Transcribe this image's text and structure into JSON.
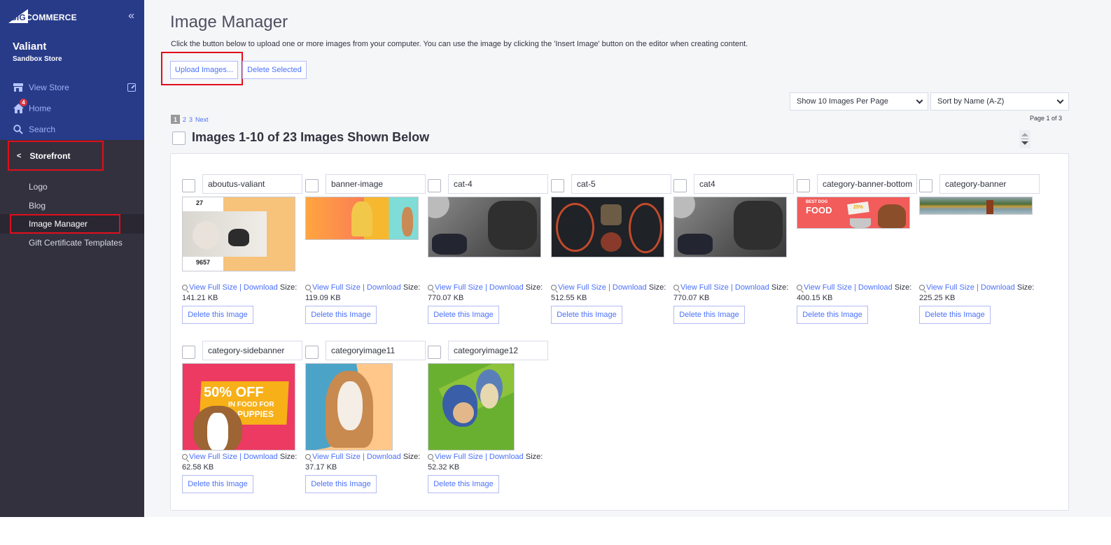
{
  "sidebar": {
    "logo": {
      "big": "BIG",
      "rest": "COMMERCE"
    },
    "collapse_icon": "«",
    "store_name": "Valiant",
    "store_sub": "Sandbox Store",
    "nav": {
      "view_store": "View Store",
      "home": "Home",
      "home_badge": "4",
      "search": "Search"
    },
    "section": {
      "label": "Storefront",
      "chevron": "<"
    },
    "sub_items": [
      "Logo",
      "Blog",
      "Image Manager",
      "Gift Certificate Templates"
    ],
    "active_item": "Image Manager"
  },
  "main": {
    "title": "Image Manager",
    "intro": "Click the button below to upload one or more images from your computer. You can use the image by clicking the 'Insert Image' button on the editor when creating content.",
    "buttons": {
      "upload": "Upload Images...",
      "delete_selected": "Delete Selected"
    },
    "per_page": {
      "selected": "Show 10 Images Per Page"
    },
    "sort": {
      "selected": "Sort by Name (A-Z)"
    },
    "page_of": "Page 1 of 3",
    "pager": {
      "current": "1",
      "pages": [
        "2",
        "3"
      ],
      "next": "Next"
    },
    "shown": "Images 1-10 of 23 Images Shown Below",
    "labels": {
      "view_full": "View Full Size",
      "separator": "|",
      "download": "Download",
      "size_label": "Size:",
      "delete": "Delete this Image"
    },
    "images": [
      {
        "name": "aboutus-valiant",
        "size": "141.21 KB",
        "stat1": "27",
        "stat2": "9657"
      },
      {
        "name": "banner-image",
        "size": "119.09 KB"
      },
      {
        "name": "cat-4",
        "size": "770.07 KB"
      },
      {
        "name": "cat-5",
        "size": "512.55 KB"
      },
      {
        "name": "cat4",
        "size": "770.07 KB"
      },
      {
        "name": "category-banner-bottom",
        "size": "400.15 KB",
        "text1": "BEST DOG",
        "text2": "FOOD",
        "text3": "25%"
      },
      {
        "name": "category-banner",
        "size": "225.25 KB"
      },
      {
        "name": "category-sidebanner",
        "size": "62.58 KB",
        "text1": "50% OFF",
        "text2": "IN FOOD FOR",
        "text3": "PUPPIES"
      },
      {
        "name": "categoryimage11",
        "size": "37.17 KB"
      },
      {
        "name": "categoryimage12",
        "size": "52.32 KB"
      }
    ]
  }
}
